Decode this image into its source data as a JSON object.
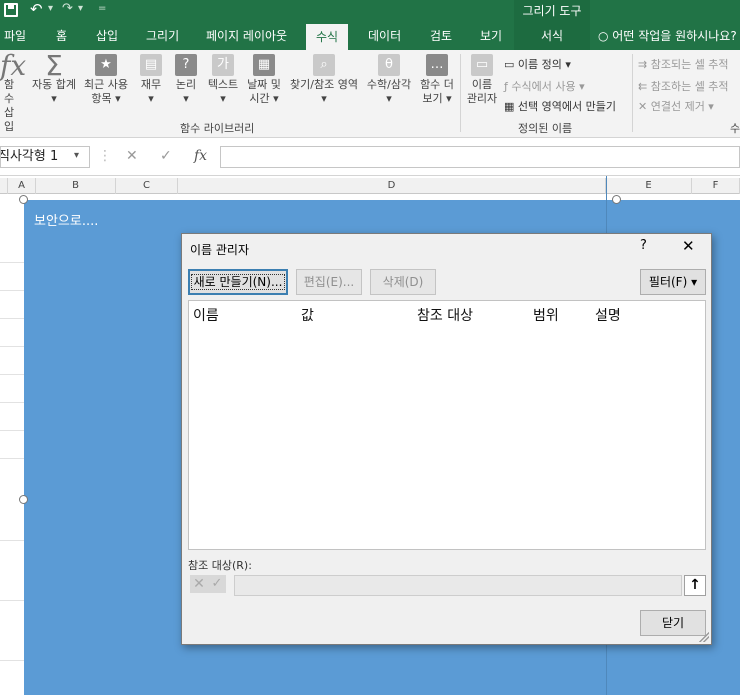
{
  "titlebar": {
    "context_group": "그리기 도구",
    "qat_undo": "↶",
    "qat_redo": "↷",
    "qat_dropdown": "▾",
    "qat_customize": "="
  },
  "tabs": {
    "file": "파일",
    "home": "홈",
    "insert": "삽입",
    "draw": "그리기",
    "page_layout": "페이지 레이아웃",
    "formulas": "수식",
    "data": "데이터",
    "review": "검토",
    "view": "보기",
    "format": "서식",
    "tell_me": "어떤 작업을 원하시나요?"
  },
  "ribbon": {
    "insert_function_top": "함수",
    "insert_function_bottom": "삽입",
    "autosum": "자동 합계",
    "recent": "최근 사용",
    "recent_sub": "항목 ▾",
    "financial": "재무",
    "logical": "논리",
    "text": "텍스트",
    "datetime": "날짜 및",
    "datetime_sub": "시간 ▾",
    "lookup": "찾기/참조 영역",
    "math": "수학/삼각",
    "more": "함수 더",
    "more_sub": "보기 ▾",
    "name_manager_top": "이름",
    "name_manager_bottom": "관리자",
    "define_name": "이름 정의 ▾",
    "use_in_formula": "수식에서 사용 ▾",
    "create_from_selection": "선택 영역에서 만들기",
    "trace_precedents": "참조되는 셀 추적",
    "trace_dependents": "참조하는 셀 추적",
    "remove_arrows": "연결선 제거 ▾",
    "group_function_library": "함수 라이브러리",
    "group_defined_names": "정의된 이름",
    "group_formula_auditing": "수"
  },
  "formula_bar": {
    "name_box": "직사각형 1",
    "cancel_icon": "✕",
    "enter_icon": "✓",
    "fx": "fx",
    "formula": ""
  },
  "columns": [
    "A",
    "B",
    "C",
    "D",
    "E",
    "F"
  ],
  "shape": {
    "text": "보안으로...."
  },
  "dialog": {
    "title": "이름 관리자",
    "help": "?",
    "close": "✕",
    "new_button": "새로 만들기(N)...",
    "edit_button": "편집(E)...",
    "delete_button": "삭제(D)",
    "filter_button": "필터(F) ▾",
    "list_headers": [
      "이름",
      "값",
      "참조 대상",
      "범위",
      "설명"
    ],
    "refers_to_label": "참조 대상(R):",
    "refers_to_value": "",
    "collapse_icon": "🠕",
    "close_button": "닫기"
  },
  "colors": {
    "excel_green": "#217346",
    "shape_blue": "#5b9bd5"
  }
}
